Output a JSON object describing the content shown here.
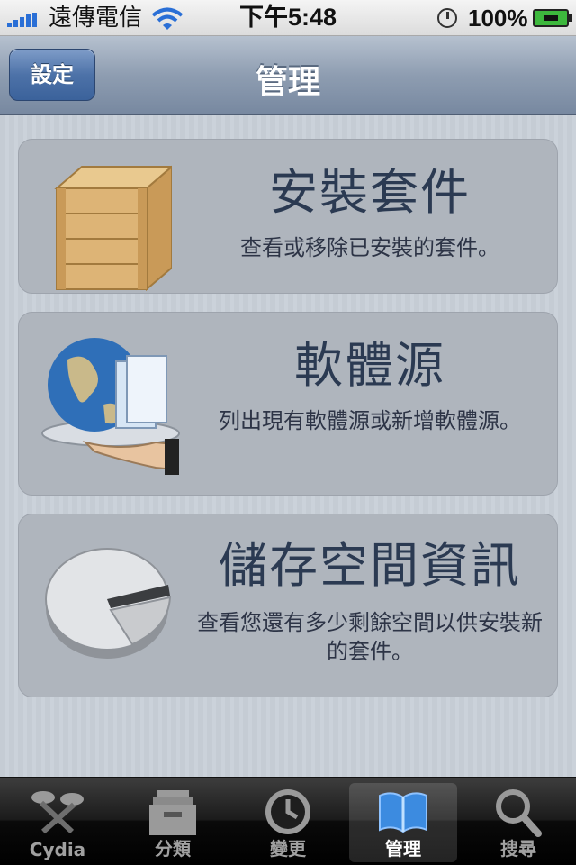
{
  "status_bar": {
    "carrier": "遠傳電信",
    "time": "下午5:48",
    "battery_percent": "100%",
    "icons": [
      "signal-icon",
      "wifi-icon",
      "alarm-icon",
      "battery-charging-icon"
    ]
  },
  "nav": {
    "back_label": "設定",
    "title": "管理"
  },
  "items": [
    {
      "title": "安裝套件",
      "description": "查看或移除已安裝的套件。",
      "icon": "package-box-icon"
    },
    {
      "title": "軟體源",
      "description": "列出現有軟體源或新增軟體源。",
      "icon": "globe-sources-icon"
    },
    {
      "title": "儲存空間資訊",
      "description": "查看您還有多少剩餘空間以供安裝新的套件。",
      "icon": "pie-chart-icon"
    }
  ],
  "tabs": [
    {
      "label": "Cydia",
      "icon": "cydia-icon",
      "active": false
    },
    {
      "label": "分類",
      "icon": "sections-icon",
      "active": false
    },
    {
      "label": "變更",
      "icon": "clock-icon",
      "active": false
    },
    {
      "label": "管理",
      "icon": "book-icon",
      "active": true
    },
    {
      "label": "搜尋",
      "icon": "search-icon",
      "active": false
    }
  ],
  "colors": {
    "nav_gradient_top": "#b6c1cf",
    "nav_gradient_bottom": "#7788a0",
    "back_button": "#4d72a8",
    "card_background": "#afb5bd",
    "card_title": "#2b3a52",
    "active_tab_icon": "#3c8be0"
  }
}
